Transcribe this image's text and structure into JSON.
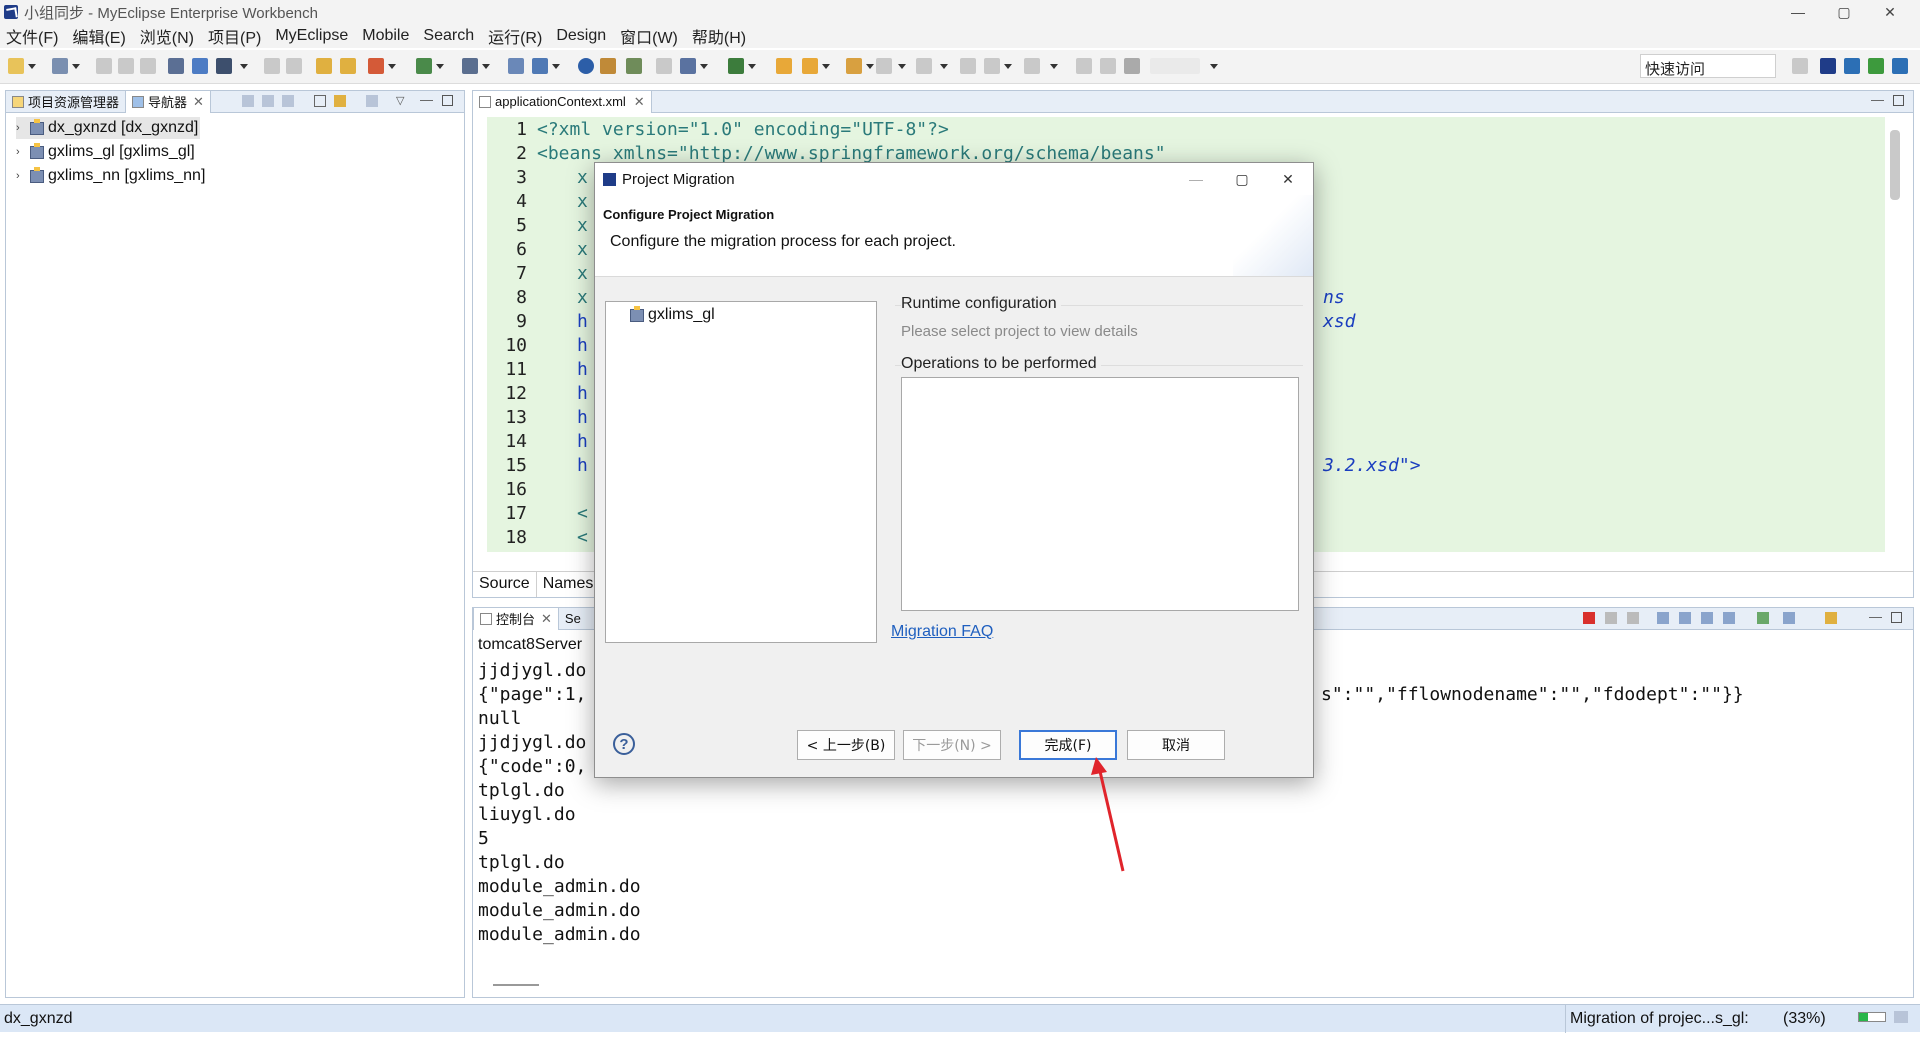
{
  "window": {
    "title": "小组同步 - MyEclipse Enterprise Workbench",
    "controls": [
      "—",
      "▢",
      "✕"
    ]
  },
  "menubar": {
    "items": [
      "文件(F)",
      "编辑(E)",
      "浏览(N)",
      "项目(P)",
      "MyEclipse",
      "Mobile",
      "Search",
      "运行(R)",
      "Design",
      "窗口(W)",
      "帮助(H)"
    ]
  },
  "toolbar": {
    "quick_access": "快速访问"
  },
  "left_panel": {
    "tabs": [
      "项目资源管理器",
      "导航器"
    ],
    "tab_close": "✕",
    "projects": [
      "dx_gxnzd [dx_gxnzd]",
      "gxlims_gl [gxlims_gl]",
      "gxlims_nn [gxlims_nn]"
    ]
  },
  "editor": {
    "tab_label": "applicationContext.xml",
    "tab_close": "✕",
    "lines": [
      {
        "n": "1",
        "text": "<?xml version=\"1.0\" encoding=\"UTF-8\"?>"
      },
      {
        "n": "2",
        "text": "<beans xmlns=\"http://www.springframework.org/schema/beans\""
      },
      {
        "n": "3",
        "text": "x"
      },
      {
        "n": "4",
        "text": "x"
      },
      {
        "n": "5",
        "text": "x"
      },
      {
        "n": "6",
        "text": "x"
      },
      {
        "n": "7",
        "text": "x"
      },
      {
        "n": "8",
        "text": "x"
      },
      {
        "n": "9",
        "text": "h"
      },
      {
        "n": "10",
        "text": "h"
      },
      {
        "n": "11",
        "text": "h"
      },
      {
        "n": "12",
        "text": "h"
      },
      {
        "n": "13",
        "text": "h"
      },
      {
        "n": "14",
        "text": "h"
      },
      {
        "n": "15",
        "text": "h"
      },
      {
        "n": "16",
        "text": ""
      },
      {
        "n": "17",
        "text": "<"
      },
      {
        "n": "18",
        "text": "<"
      }
    ],
    "right_fragments": {
      "line8": "ns",
      "line9": "xsd",
      "line15": "3.2.xsd\">"
    },
    "bottom_tabs": [
      "Source",
      "Names"
    ]
  },
  "console": {
    "tabs": [
      "控制台",
      "Se"
    ],
    "server": "tomcat8Server",
    "lines": [
      "jjdjygl.do",
      "{\"page\":1,",
      "null",
      "jjdjygl.do",
      "{\"code\":0,",
      "tplgl.do",
      "liuygl.do",
      "5",
      "tplgl.do",
      "module_admin.do",
      "module_admin.do",
      "module_admin.do"
    ],
    "line2_tail": "s\":\"\",\"fflownodename\":\"\",\"fdodept\":\"\"}}"
  },
  "statusbar": {
    "left": "dx_gxnzd",
    "task": "Migration of projec...s_gl:",
    "percent": "(33%)",
    "progress_fraction": 0.33
  },
  "dialog": {
    "title": "Project Migration",
    "heading": "Configure Project Migration",
    "description": "Configure the migration process for each project.",
    "project_item": "gxlims_gl",
    "runtime_label": "Runtime configuration",
    "runtime_hint": "Please select project to view details",
    "operations_label": "Operations to be performed",
    "faq_link": "Migration FAQ",
    "help": "?",
    "buttons": {
      "back": "< 上一步(B)",
      "next": "下一步(N) >",
      "finish": "完成(F)",
      "cancel": "取消"
    }
  },
  "colors": {
    "editor_highlight": "#e5f5e0",
    "annotation_arrow": "#e0242b",
    "finish_border": "#3a78d8"
  }
}
